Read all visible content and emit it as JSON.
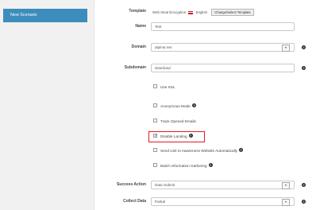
{
  "sidebar": {
    "new_scenario_label": "New Scenario"
  },
  "form": {
    "template": {
      "label": "Template",
      "value": "Web Steal Encryption",
      "language": "English",
      "change_button": "Change/Select Template"
    },
    "name": {
      "label": "Name",
      "value": "Test"
    },
    "domain": {
      "label": "Domain",
      "value": "alpinor.net"
    },
    "subdomain": {
      "label": "Subdomain",
      "value": "download"
    },
    "checkboxes": {
      "use_ssl": "Use SSL",
      "anonymous_mode": "Anonymous Mode",
      "track_opened_emails": "Track Opened Emails",
      "disable_landing": "Disable Landing",
      "send_unit_awareness": "Send Unit to Awareness Website Automatically",
      "batch_info_gathering": "Batch Information Gathering"
    },
    "success_action": {
      "label": "Success Action",
      "value": "Data Submit"
    },
    "collect_data": {
      "label": "Collect Data",
      "value": "Partial"
    }
  },
  "colors": {
    "accent": "#3c8dbc",
    "highlight": "#e01b24"
  }
}
